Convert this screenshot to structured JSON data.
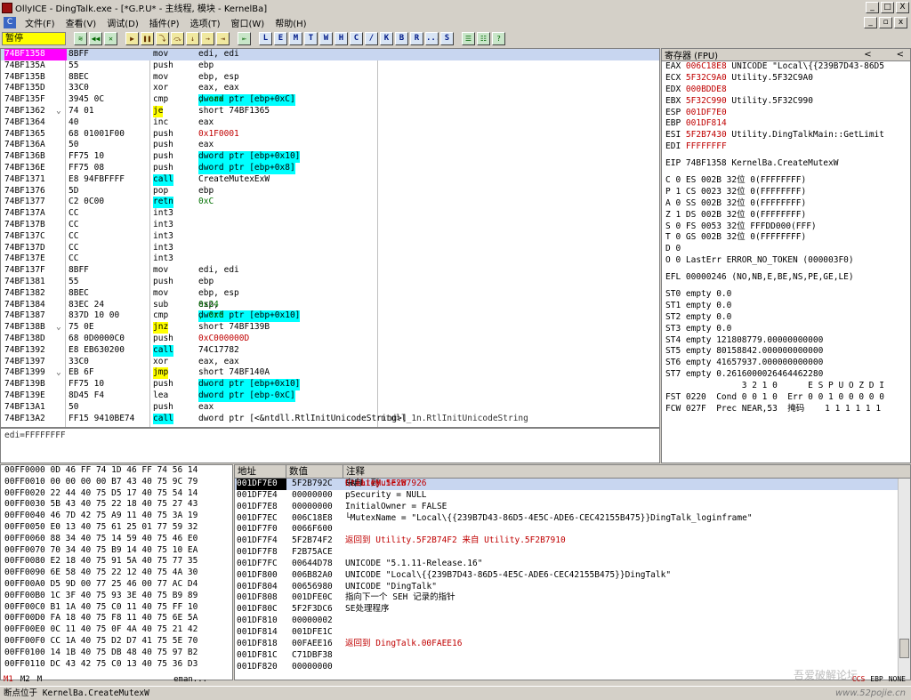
{
  "titlebar": {
    "title": "OllyICE - DingTalk.exe - [*G.P.U* - 主线程, 模块 - KernelBa]",
    "minimize": "_",
    "maximize": "□",
    "close": "X"
  },
  "menubar": {
    "icon": "C",
    "items": [
      "文件(F)",
      "查看(V)",
      "调试(D)",
      "插件(P)",
      "选项(T)",
      "窗口(W)",
      "帮助(H)"
    ],
    "mdi": [
      "_",
      "▫",
      "x"
    ]
  },
  "toolbar": {
    "status": "暂停",
    "group1": [
      "≋",
      "◀◀",
      "✕"
    ],
    "group2": [
      "▶",
      "❚❚",
      "⤵",
      "⤼",
      "↓",
      "→",
      "⇥"
    ],
    "group3": [
      "⇤"
    ],
    "letters": [
      "L",
      "E",
      "M",
      "T",
      "W",
      "H",
      "C",
      "/",
      "K",
      "B",
      "R",
      "...",
      "S"
    ],
    "group4": [
      "☰",
      "☷",
      "?"
    ]
  },
  "cpu": {
    "rows": [
      {
        "addr": "74BF1358",
        "arrow": "",
        "hex": "8BFF",
        "mn": "mov",
        "op": "edi, edi",
        "sel": true
      },
      {
        "addr": "74BF135A",
        "arrow": "",
        "hex": "55",
        "mn": "push",
        "op": "ebp"
      },
      {
        "addr": "74BF135B",
        "arrow": "",
        "hex": "8BEC",
        "mn": "mov",
        "op": "ebp, esp"
      },
      {
        "addr": "74BF135D",
        "arrow": "",
        "hex": "33C0",
        "mn": "xor",
        "op": "eax, eax"
      },
      {
        "addr": "74BF135F",
        "arrow": "",
        "hex": "3945 0C",
        "mn": "cmp",
        "op": "dword ptr [ebp+0xC]",
        "op2": ", eax",
        "hl": "cyan"
      },
      {
        "addr": "74BF1362",
        "arrow": "⌄",
        "hex": "74 01",
        "mn": "je",
        "op": "short 74BF1365",
        "mnhl": "yellow"
      },
      {
        "addr": "74BF1364",
        "arrow": "",
        "hex": "40",
        "mn": "inc",
        "op": "eax"
      },
      {
        "addr": "74BF1365",
        "arrow": "",
        "hex": "68 01001F00",
        "mn": "push",
        "op": "0x1F0001",
        "opc": "red"
      },
      {
        "addr": "74BF136A",
        "arrow": "",
        "hex": "50",
        "mn": "push",
        "op": "eax"
      },
      {
        "addr": "74BF136B",
        "arrow": "",
        "hex": "FF75 10",
        "mn": "push",
        "op": "dword ptr [ebp+0x10]",
        "hl": "cyan"
      },
      {
        "addr": "74BF136E",
        "arrow": "",
        "hex": "FF75 08",
        "mn": "push",
        "op": "dword ptr [ebp+0x8]",
        "hl": "cyan"
      },
      {
        "addr": "74BF1371",
        "arrow": "",
        "hex": "E8 94FBFFFF",
        "mn": "call",
        "op": "CreateMutexExW",
        "mnhl": "cyan"
      },
      {
        "addr": "74BF1376",
        "arrow": "",
        "hex": "5D",
        "mn": "pop",
        "op": "ebp"
      },
      {
        "addr": "74BF1377",
        "arrow": "",
        "hex": "C2 0C00",
        "mn": "retn",
        "op": "0xC",
        "mnhl": "cyan",
        "opc": "grn"
      },
      {
        "addr": "74BF137A",
        "arrow": "",
        "hex": "CC",
        "mn": "int3",
        "op": ""
      },
      {
        "addr": "74BF137B",
        "arrow": "",
        "hex": "CC",
        "mn": "int3",
        "op": ""
      },
      {
        "addr": "74BF137C",
        "arrow": "",
        "hex": "CC",
        "mn": "int3",
        "op": ""
      },
      {
        "addr": "74BF137D",
        "arrow": "",
        "hex": "CC",
        "mn": "int3",
        "op": ""
      },
      {
        "addr": "74BF137E",
        "arrow": "",
        "hex": "CC",
        "mn": "int3",
        "op": ""
      },
      {
        "addr": "74BF137F",
        "arrow": "",
        "hex": "8BFF",
        "mn": "mov",
        "op": "edi, edi"
      },
      {
        "addr": "74BF1381",
        "arrow": "",
        "hex": "55",
        "mn": "push",
        "op": "ebp"
      },
      {
        "addr": "74BF1382",
        "arrow": "",
        "hex": "8BEC",
        "mn": "mov",
        "op": "ebp, esp"
      },
      {
        "addr": "74BF1384",
        "arrow": "",
        "hex": "83EC 24",
        "mn": "sub",
        "op": "esp, ",
        "op3": "0x24"
      },
      {
        "addr": "74BF1387",
        "arrow": "",
        "hex": "837D 10 00",
        "mn": "cmp",
        "op": "dword ptr [ebp+0x10]",
        "op2": ", 0x0",
        "hl": "cyan"
      },
      {
        "addr": "74BF138B",
        "arrow": "⌄",
        "hex": "75 0E",
        "mn": "jnz",
        "op": "short 74BF139B",
        "mnhl": "yellow"
      },
      {
        "addr": "74BF138D",
        "arrow": "",
        "hex": "68 0D0000C0",
        "mn": "push",
        "op": "0xC000000D",
        "opc": "red"
      },
      {
        "addr": "74BF1392",
        "arrow": "",
        "hex": "E8 EB630200",
        "mn": "call",
        "op": "74C17782",
        "mnhl": "cyan"
      },
      {
        "addr": "74BF1397",
        "arrow": "",
        "hex": "33C0",
        "mn": "xor",
        "op": "eax, eax"
      },
      {
        "addr": "74BF1399",
        "arrow": "⌄",
        "hex": "EB 6F",
        "mn": "jmp",
        "op": "short 74BF140A",
        "mnhl": "yellow"
      },
      {
        "addr": "74BF139B",
        "arrow": "",
        "hex": "FF75 10",
        "mn": "push",
        "op": "dword ptr [ebp+0x10]",
        "hl": "cyan"
      },
      {
        "addr": "74BF139E",
        "arrow": "",
        "hex": "8D45 F4",
        "mn": "lea",
        "op": "eax, ",
        "op4": "dword ptr [ebp-0xC]"
      },
      {
        "addr": "74BF13A1",
        "arrow": "",
        "hex": "50",
        "mn": "push",
        "op": "eax"
      },
      {
        "addr": "74BF13A2",
        "arrow": "",
        "hex": "FF15 9410BE74",
        "mn": "call",
        "op": "dword ptr [<&ntdll.RtlInitUnicodeString>]",
        "mnhl": "cyan",
        "cm": "ntdll_1n.RtlInitUnicodeString"
      }
    ]
  },
  "info": {
    "text": "edi=FFFFFFFF"
  },
  "registers": {
    "header": "寄存器 (FPU)",
    "nav": [
      "<",
      "<"
    ],
    "gp": [
      {
        "n": "EAX",
        "v": "006C18E8",
        "c": "UNICODE \"Local\\{{239B7D43-86D5"
      },
      {
        "n": "ECX",
        "v": "5F32C9A0",
        "c": "Utility.5F32C9A0"
      },
      {
        "n": "EDX",
        "v": "000BDDE8",
        "c": ""
      },
      {
        "n": "EBX",
        "v": "5F32C990",
        "c": "Utility.5F32C990"
      },
      {
        "n": "ESP",
        "v": "001DF7E0",
        "c": ""
      },
      {
        "n": "EBP",
        "v": "001DF814",
        "c": ""
      },
      {
        "n": "ESI",
        "v": "5F2B7430",
        "c": "Utility.DingTalkMain::GetLimit"
      },
      {
        "n": "EDI",
        "v": "FFFFFFFF",
        "c": ""
      }
    ],
    "eip": "EIP 74BF1358 KernelBa.CreateMutexW",
    "flags": [
      {
        "t": "C 0  ES 002B 32位 0(FFFFFFFF)",
        "red": ""
      },
      {
        "t": "P 1  CS 0023 32位 0(FFFFFFFF)",
        "red": "1"
      },
      {
        "t": "A 0  SS 002B 32位 0(FFFFFFFF)",
        "red": ""
      },
      {
        "t": "Z 1  DS 002B 32位 0(FFFFFFFF)",
        "red": "1"
      },
      {
        "t": "S 0  FS 0053 32位 FFFDD000(FFF)",
        "red": ""
      },
      {
        "t": "T 0  GS 002B 32位 0(FFFFFFFF)",
        "red": ""
      },
      {
        "t": "D 0",
        "red": ""
      },
      {
        "t": "O 0  LastErr ERROR_NO_TOKEN (000003F0)",
        "red": ""
      }
    ],
    "efl": "EFL 00000246 (NO,NB,E,BE,NS,PE,GE,LE)",
    "fpu": [
      "ST0 empty 0.0",
      "ST1 empty 0.0",
      "ST2 empty 0.0",
      "ST3 empty 0.0",
      "ST4 empty 121808779.00000000000",
      "ST5 empty 80158842.000000000000",
      "ST6 empty 41657937.000000000000",
      "ST7 empty 0.2616000026464462280"
    ],
    "fpu_hdr": "               3 2 1 0      E S P U O Z D I",
    "fst": "FST 0220  Cond 0 0 1 0  Err 0 0 1 0 0 0 0 0",
    "fcw": "FCW 027F  Prec NEAR,53  掩码    1 1 1 1 1 1"
  },
  "dump": {
    "rows": [
      "00FF0000 0D 46 FF 74 1D 46 FF 74 56 14",
      "00FF0010 00 00 00 00 B7 43 40 75 9C 79",
      "00FF0020 22 44 40 75 D5 17 40 75 54 14",
      "00FF0030 5B 43 40 75 22 18 40 75 27 43",
      "00FF0040 46 7D 42 75 A9 11 40 75 3A 19",
      "00FF0050 E0 13 40 75 61 25 01 77 59 32",
      "00FF0060 88 34 40 75 14 59 40 75 46 E0",
      "00FF0070 70 34 40 75 B9 14 40 75 10 EA",
      "00FF0080 E2 18 40 75 91 5A 40 75 77 35",
      "00FF0090 6E 58 40 75 22 12 40 75 4A 30",
      "00FF00A0 D5 9D 00 77 25 46 00 77 AC D4",
      "00FF00B0 1C 3F 40 75 93 3E 40 75 B9 89",
      "00FF00C0 B1 1A 40 75 C0 11 40 75 FF 10",
      "00FF00D0 FA 18 40 75 F8 11 40 75 6E 5A",
      "00FF00E0 0C 11 40 75 0F 4A 40 75 21 42",
      "00FF00F0 CC 1A 40 75 D2 D7 41 75 5E 70",
      "00FF0100 14 1B 40 75 DB 48 40 75 97 B2",
      "00FF0110 DC 43 42 75 C0 13 40 75 36 D3"
    ]
  },
  "stack": {
    "headers": [
      "地址",
      "数值",
      "注释"
    ],
    "rows": [
      {
        "a": "001DF7E0",
        "v": "5F2B792C",
        "c1": "CALL 到 ",
        "c2": "CreateMutexW",
        "c3": " 来自 ",
        "c4": "Utility.5F2B7926",
        "sel": true
      },
      {
        "a": "001DF7E4",
        "v": "00000000",
        "c": " pSecurity = NULL"
      },
      {
        "a": "001DF7E8",
        "v": "00000000",
        "c": " InitialOwner = FALSE"
      },
      {
        "a": "001DF7EC",
        "v": "006C18E8",
        "c": "└MutexName = \"Local\\{{239B7D43-86D5-4E5C-ADE6-CEC42155B475}}DingTalk_loginframe\""
      },
      {
        "a": "001DF7F0",
        "v": "0066F600",
        "c": ""
      },
      {
        "a": "001DF7F4",
        "v": "5F2B74F2",
        "c": "返回到 Utility.5F2B74F2 来自 Utility.5F2B7910",
        "red": true
      },
      {
        "a": "001DF7F8",
        "v": "F2B75ACE",
        "c": ""
      },
      {
        "a": "001DF7FC",
        "v": "00644D78",
        "c": "UNICODE \"5.1.11-Release.16\""
      },
      {
        "a": "001DF800",
        "v": "006B82A0",
        "c": "UNICODE \"Local\\{{239B7D43-86D5-4E5C-ADE6-CEC42155B475}}DingTalk\""
      },
      {
        "a": "001DF804",
        "v": "00656980",
        "c": "UNICODE \"DingTalk\""
      },
      {
        "a": "001DF808",
        "v": "001DFE0C",
        "c": "指向下一个 SEH 记录的指针"
      },
      {
        "a": "001DF80C",
        "v": "5F2F3DC6",
        "c": "SE处理程序"
      },
      {
        "a": "001DF810",
        "v": "00000002",
        "c": ""
      },
      {
        "a": "001DF814",
        "v": "001DFE1C",
        "c": ""
      },
      {
        "a": "001DF818",
        "v": "00FAEE16",
        "c": "返回到 DingTalk.00FAEE16",
        "red": true
      },
      {
        "a": "001DF81C",
        "v": "C71DBF38",
        "c": ""
      },
      {
        "a": "001DF820",
        "v": "00000000",
        "c": ""
      }
    ]
  },
  "tabbar": {
    "tabs": [
      "M1",
      "M2",
      "M"
    ],
    "extra": "eman...",
    "right": [
      "CCS",
      "EBP",
      "NONE"
    ]
  },
  "statusbar": {
    "text": "断点位于 KernelBa.CreateMutexW",
    "watermark": "www.52pojie.cn",
    "watermark_top": "吾爱破解论坛"
  }
}
